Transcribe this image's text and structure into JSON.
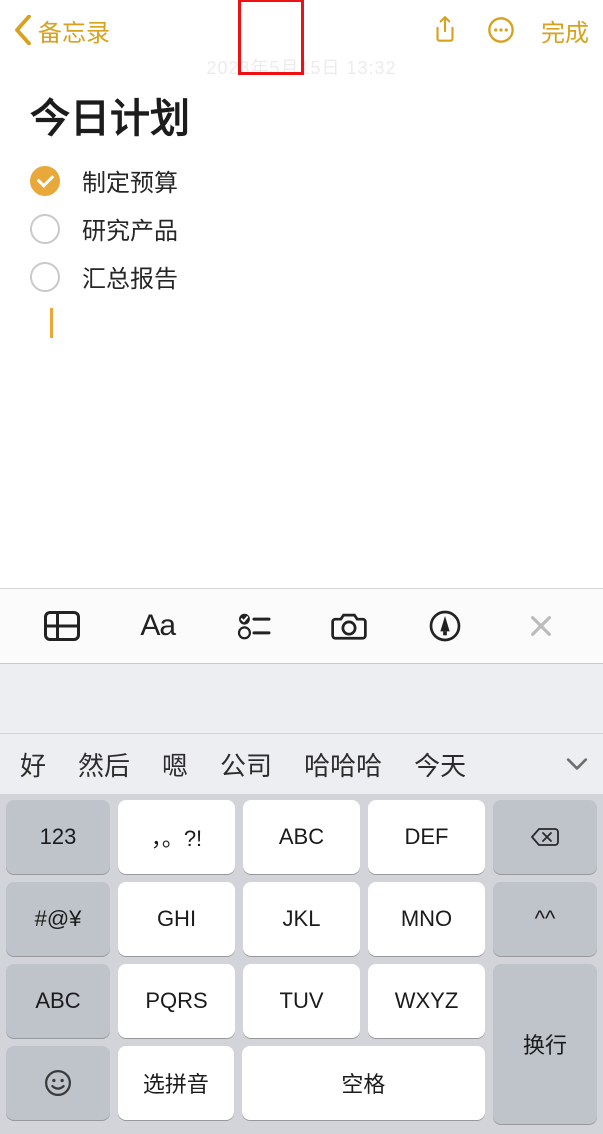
{
  "header": {
    "back_label": "备忘录",
    "done_label": "完成"
  },
  "note": {
    "timestamp": "2023年5月15日 13:32",
    "title": "今日计划",
    "checklist": [
      {
        "text": "制定预算",
        "checked": true
      },
      {
        "text": "研究产品",
        "checked": false
      },
      {
        "text": "汇总报告",
        "checked": false
      }
    ]
  },
  "toolbar": {
    "format_label": "Aa"
  },
  "keyboard": {
    "candidates": [
      "好",
      "然后",
      "嗯",
      "公司",
      "哈哈哈",
      "今天"
    ],
    "side_left": [
      "123",
      "#@¥",
      "ABC"
    ],
    "main_rows": [
      [
        "，。?!",
        "ABC",
        "DEF"
      ],
      [
        "GHI",
        "JKL",
        "MNO"
      ],
      [
        "PQRS",
        "TUV",
        "WXYZ"
      ]
    ],
    "side_right_top": "delete",
    "side_right_mid": "^^",
    "enter_label": "换行",
    "pinyin_label": "选拼音",
    "space_label": "空格"
  }
}
